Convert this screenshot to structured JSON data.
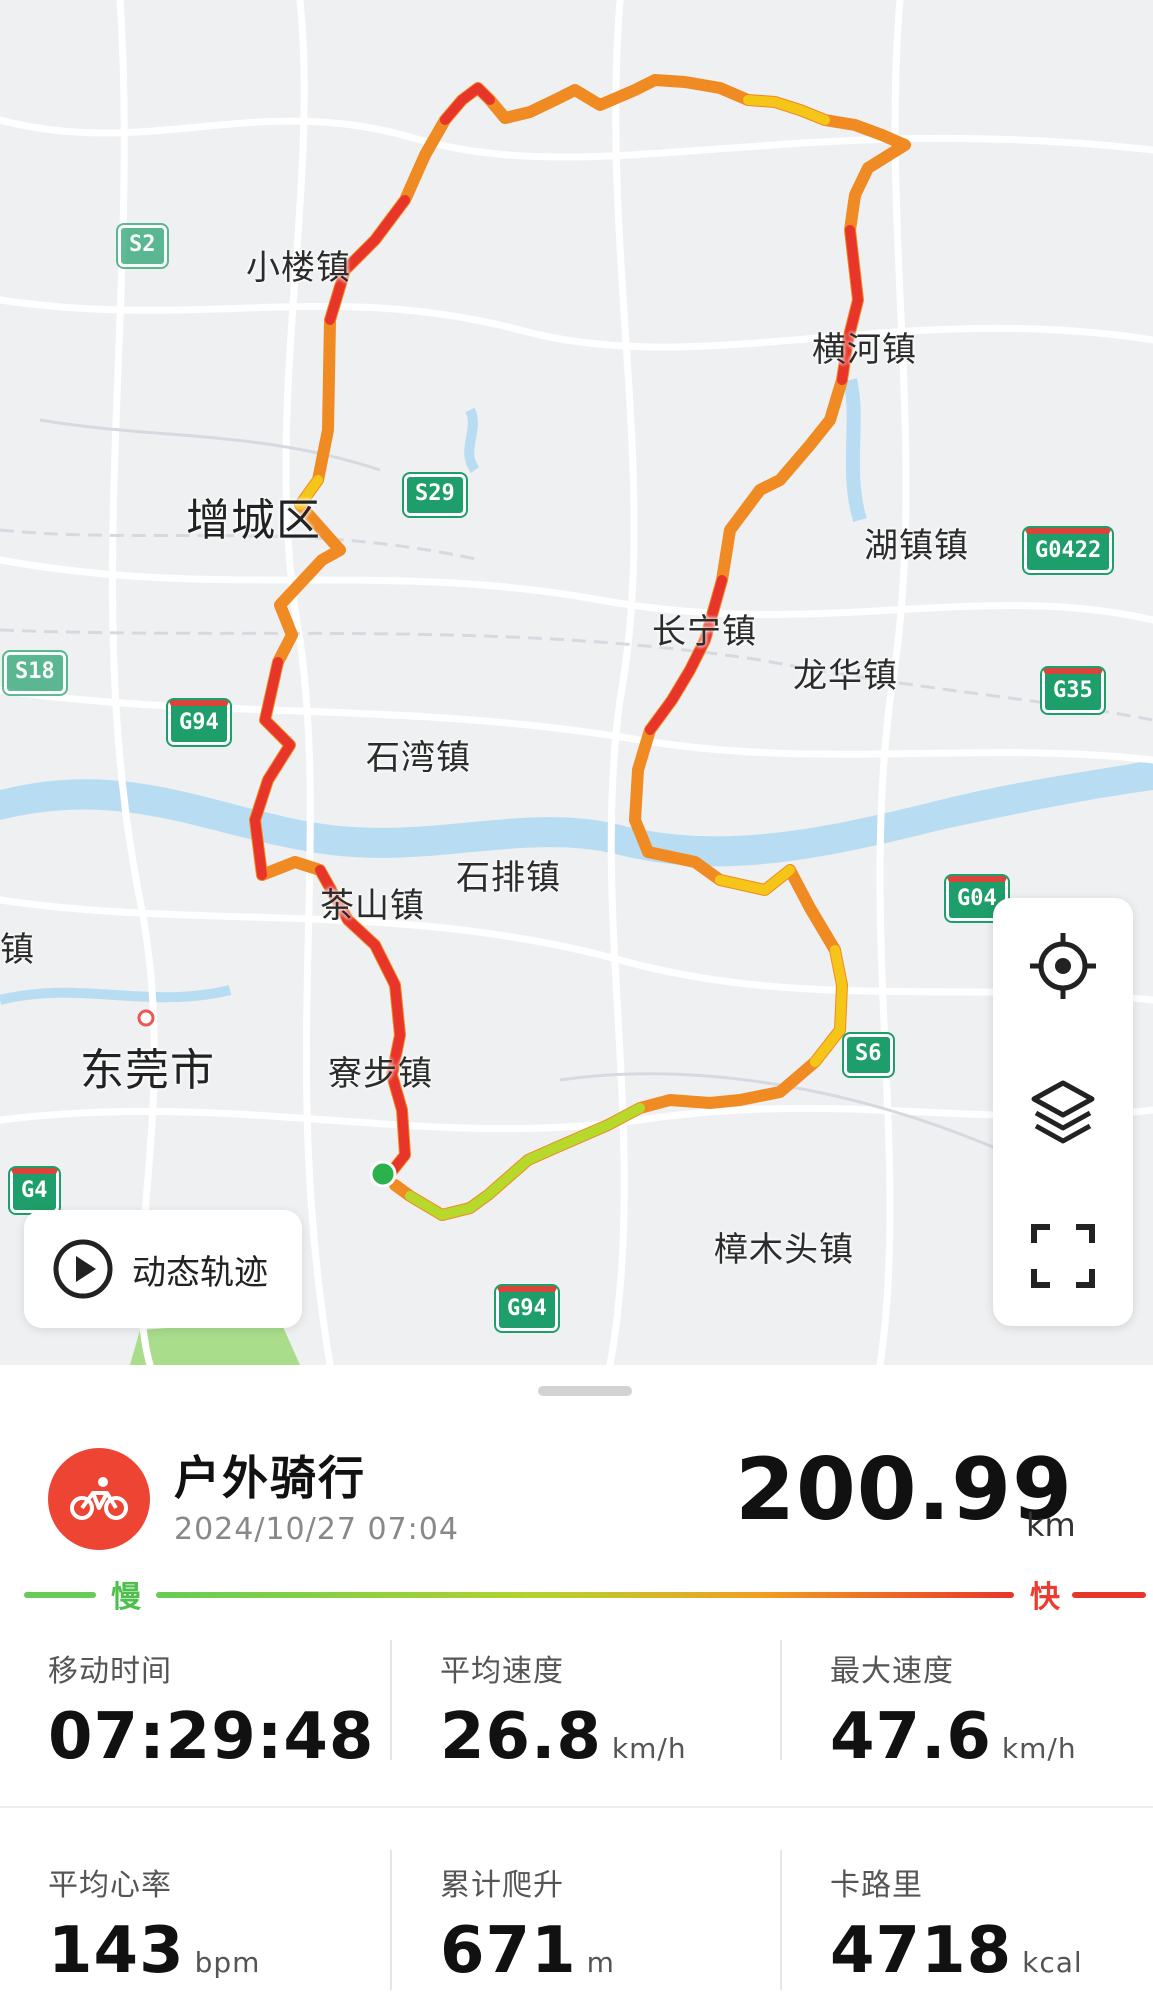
{
  "map": {
    "places": {
      "xiaolou": "小楼镇",
      "zengcheng": "增城区",
      "henghe": "横河镇",
      "huzhen": "湖镇镇",
      "changning": "长宁镇",
      "longhua": "龙华镇",
      "shiwan": "石湾镇",
      "shipai": "石排镇",
      "chashan": "茶山镇",
      "dongguan": "东莞市",
      "liaobu": "寮步镇",
      "zhangmutou": "樟木头镇",
      "zhen_edge": "镇"
    },
    "shields": {
      "s2": "S2",
      "s29": "S29",
      "g0422": "G0422",
      "s18": "S18",
      "g94_left": "G94",
      "g35": "G35",
      "g04xx": "G04",
      "s6": "S6",
      "g4": "G4",
      "g94_bottom": "G94"
    },
    "replay_label": "动态轨迹",
    "controls": [
      "locate-icon",
      "layers-icon",
      "fullscreen-icon"
    ],
    "colors": {
      "route_slow": "#7ed321",
      "route_mid": "#f5c518",
      "route_fast": "#e8352a",
      "start_dot": "#2bb24c",
      "water": "#b8dcf2"
    }
  },
  "activity": {
    "title": "户外骑行",
    "datetime": "2024/10/27 07:04",
    "distance": "200.99",
    "distance_unit": "km",
    "legend_slow": "慢",
    "legend_fast": "快",
    "icon": "bicycle-icon",
    "accent": "#ee4433"
  },
  "stats": {
    "moving_time": {
      "label": "移动时间",
      "value": "07:29:48",
      "unit": ""
    },
    "avg_speed": {
      "label": "平均速度",
      "value": "26.8",
      "unit": "km/h"
    },
    "max_speed": {
      "label": "最大速度",
      "value": "47.6",
      "unit": "km/h"
    },
    "avg_hr": {
      "label": "平均心率",
      "value": "143",
      "unit": "bpm"
    },
    "elevation": {
      "label": "累计爬升",
      "value": "671",
      "unit": "m"
    },
    "calories": {
      "label": "卡路里",
      "value": "4718",
      "unit": "kcal"
    }
  }
}
